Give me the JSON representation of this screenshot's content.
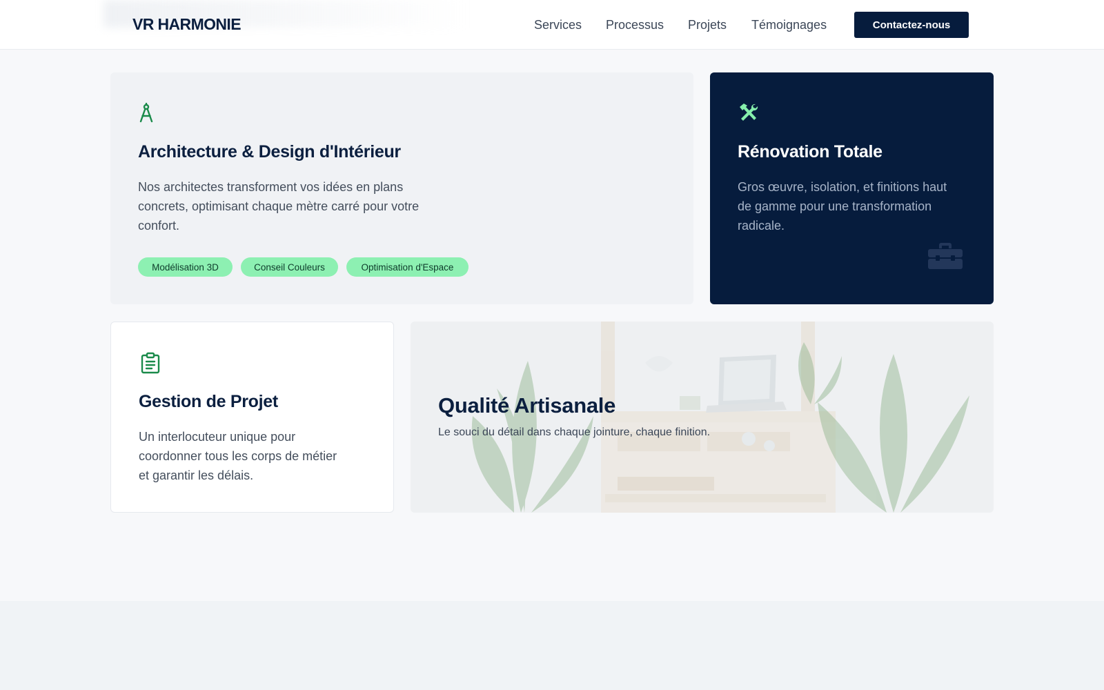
{
  "header": {
    "logo": "VR HARMONIE",
    "nav": [
      {
        "label": "Services"
      },
      {
        "label": "Processus"
      },
      {
        "label": "Projets"
      },
      {
        "label": "Témoignages"
      }
    ],
    "cta_label": "Contactez-nous"
  },
  "cards": {
    "architecture": {
      "icon": "compass-icon",
      "title": "Architecture & Design d'Intérieur",
      "text_lines": [
        "Nos architectes transforment vos idées en plans",
        "concrets, optimisant chaque mètre carré pour votre",
        "confort."
      ],
      "tags": [
        "Modélisation 3D",
        "Conseil Couleurs",
        "Optimisation d'Espace"
      ]
    },
    "renovation": {
      "icon": "tools-icon",
      "title": "Rénovation Totale",
      "text_lines": [
        "Gros œuvre, isolation, et finitions haut",
        "de gamme pour une transformation",
        "radicale."
      ],
      "decor_icon": "toolbox-icon"
    },
    "gestion": {
      "icon": "clipboard-icon",
      "title": "Gestion de Projet",
      "text_lines": [
        "Un interlocuteur unique pour",
        "coordonner tous les corps de métier",
        "et garantir les délais."
      ]
    },
    "qualite": {
      "title": "Qualité Artisanale",
      "subtitle": "Le souci du détail dans chaque jointure, chaque finition."
    }
  },
  "colors": {
    "navy": "#061c3d",
    "accent_green": "#1a8a4a",
    "tag_green": "#8df0b2",
    "mint": "#86efac"
  }
}
